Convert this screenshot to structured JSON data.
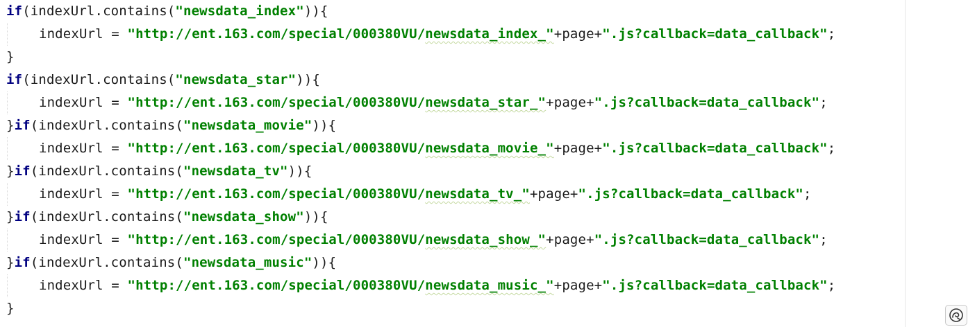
{
  "code": {
    "kw_if": "if",
    "receiver": "indexUrl",
    "method": ".contains(",
    "open_close": ")){",
    "close_brace": "}",
    "assign": " = ",
    "plus_page": "+page+",
    "semicolon": ";",
    "url_prefix": "\"http://ent.163.com/special/000380VU/",
    "url_suffix": "\".js?callback=data_callback\"",
    "blocks": [
      {
        "key": "\"newsdata_index\"",
        "path": "newsdata_index_\""
      },
      {
        "key": "\"newsdata_star\"",
        "path": "newsdata_star_\""
      },
      {
        "key": "\"newsdata_movie\"",
        "path": "newsdata_movie_\""
      },
      {
        "key": "\"newsdata_tv\"",
        "path": "newsdata_tv_\""
      },
      {
        "key": "\"newsdata_show\"",
        "path": "newsdata_show_\""
      },
      {
        "key": "\"newsdata_music\"",
        "path": "newsdata_music_\""
      }
    ]
  },
  "icons": {
    "corner": "assistant-icon"
  }
}
